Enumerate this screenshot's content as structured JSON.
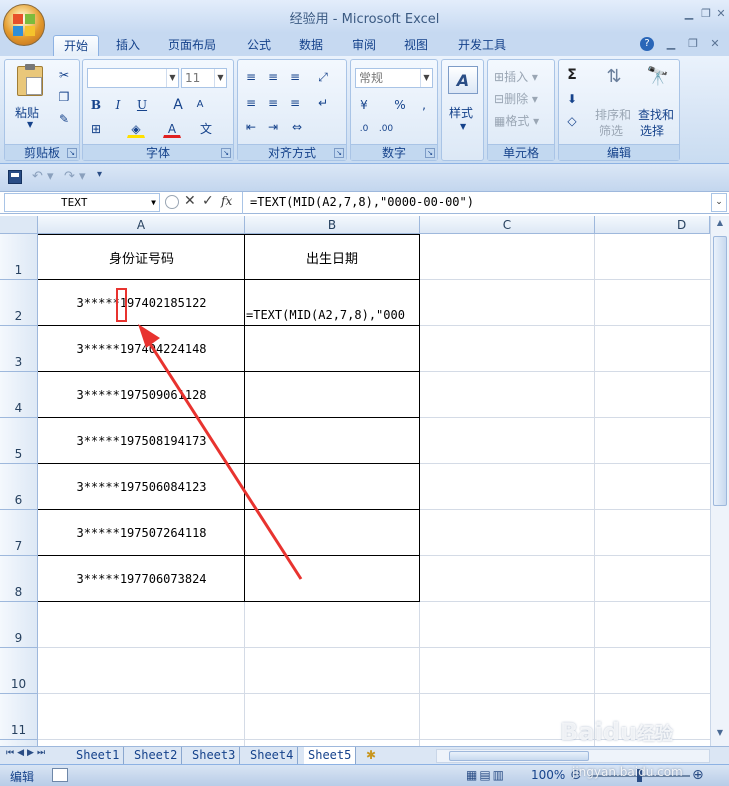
{
  "window": {
    "title": "经验用 - Microsoft Excel"
  },
  "tabs": [
    "开始",
    "插入",
    "页面布局",
    "公式",
    "数据",
    "审阅",
    "视图",
    "开发工具"
  ],
  "ribbon": {
    "clipboard": {
      "label": "剪贴板",
      "paste": "粘贴"
    },
    "font": {
      "label": "字体",
      "size": "11",
      "bold": "B",
      "italic": "I",
      "underline": "U"
    },
    "alignment": {
      "label": "对齐方式"
    },
    "number": {
      "label": "数字",
      "format": "常规",
      "percent": "%",
      "comma": ","
    },
    "styles": {
      "label": "样式"
    },
    "cells": {
      "label": "单元格",
      "insert": "插入",
      "delete": "删除",
      "format": "格式"
    },
    "editing": {
      "label": "编辑",
      "sort_filter_1": "排序和",
      "sort_filter_2": "筛选",
      "find_select_1": "查找和",
      "find_select_2": "选择"
    }
  },
  "formula_bar": {
    "name_box": "TEXT",
    "formula": "=TEXT(MID(A2,7,8),\"0000-00-00\")",
    "fx": "fx"
  },
  "columns": [
    "A",
    "B",
    "C",
    "D"
  ],
  "rows": [
    "1",
    "2",
    "3",
    "4",
    "5",
    "6",
    "7",
    "8",
    "9",
    "10",
    "11"
  ],
  "cells": {
    "A1": "身份证号码",
    "B1": "出生日期",
    "A2": "3*****197402185122",
    "B2": "=TEXT(MID(A2,7,8),\"000",
    "A3": "3*****197404224148",
    "A4": "3*****197509061128",
    "A5": "3*****197508194173",
    "A6": "3*****197506084123",
    "A7": "3*****197507264118",
    "A8": "3*****197706073824"
  },
  "sheets": [
    "Sheet1",
    "Sheet2",
    "Sheet3",
    "Sheet4",
    "Sheet5"
  ],
  "active_sheet": "Sheet5",
  "status": {
    "mode": "编辑",
    "zoom": "100%"
  },
  "watermark": {
    "brand": "Baidu",
    "jy": "经验",
    "url": "jingyan.baidu.com"
  },
  "colors": {
    "ribbon_blue": "#c6d9f1",
    "header_text": "#15428b",
    "annotation_red": "#e8332f"
  }
}
